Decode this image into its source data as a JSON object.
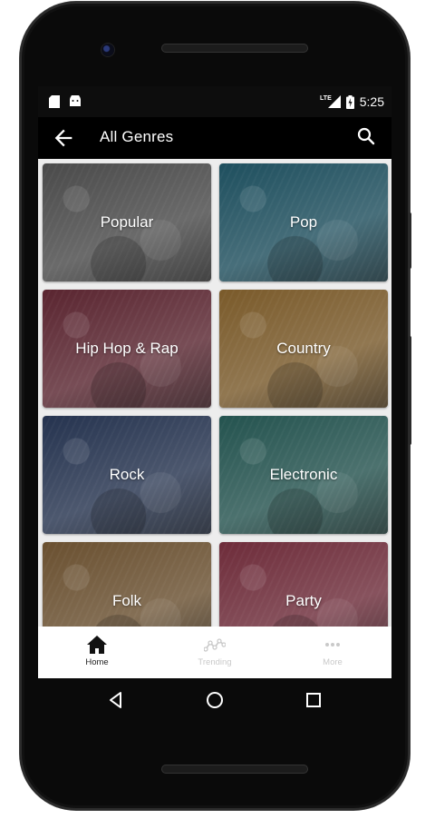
{
  "status_bar": {
    "time": "5:25",
    "network_label": "LTE"
  },
  "app_bar": {
    "title": "All Genres"
  },
  "genres": [
    {
      "label": "Popular",
      "color": "#4a4a4a"
    },
    {
      "label": "Pop",
      "color": "#1e4f5e"
    },
    {
      "label": "Hip Hop & Rap",
      "color": "#5a2530"
    },
    {
      "label": "Country",
      "color": "#7a5a2a"
    },
    {
      "label": "Rock",
      "color": "#25334f"
    },
    {
      "label": "Electronic",
      "color": "#24534f"
    },
    {
      "label": "Folk",
      "color": "#6a5030"
    },
    {
      "label": "Party",
      "color": "#6e2c3a"
    }
  ],
  "bottom_nav": {
    "items": [
      {
        "label": "Home",
        "icon": "home-icon",
        "active": true
      },
      {
        "label": "Trending",
        "icon": "trending-icon",
        "active": false
      },
      {
        "label": "More",
        "icon": "more-icon",
        "active": false
      }
    ]
  },
  "colors": {
    "accent": "#000000",
    "grid_background": "#ededed",
    "active_nav": "#222222",
    "inactive_nav": "#c9c9c9"
  }
}
